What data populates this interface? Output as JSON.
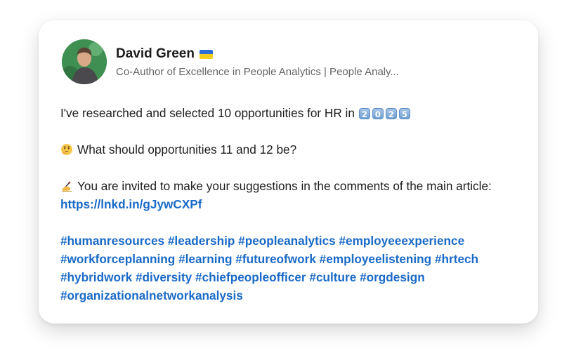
{
  "author": {
    "name": "David Green",
    "flag_icon": "ukraine-flag-icon",
    "headline": "Co-Author of Excellence in People Analytics | People Analy..."
  },
  "post": {
    "line1_text": "I've researched and selected 10 opportunities for HR in",
    "year_keycaps": [
      "2",
      "0",
      "2",
      "5"
    ],
    "line2_icon": "thinking-face-icon",
    "line2_text": "What should opportunities 11 and 12 be?",
    "line3_icon": "writing-hand-icon",
    "line3_text": "You are invited to make your suggestions in the comments of the main article:",
    "link": "https://lnkd.in/gJywCXPf",
    "hashtags": [
      "#humanresources",
      "#leadership",
      "#peopleanalytics",
      "#employeeexperience",
      "#workforceplanning",
      "#learning",
      "#futureofwork",
      "#employeelistening",
      "#hrtech",
      "#hybridwork",
      "#diversity",
      "#chiefpeopleofficer",
      "#culture",
      "#orgdesign",
      "#organizationalnetworkanalysis"
    ]
  },
  "colors": {
    "link": "#1a6ac7",
    "text": "#1d1d1d",
    "muted": "#666666",
    "flag_blue": "#2d6fd6",
    "flag_yellow": "#f5cf1d"
  }
}
